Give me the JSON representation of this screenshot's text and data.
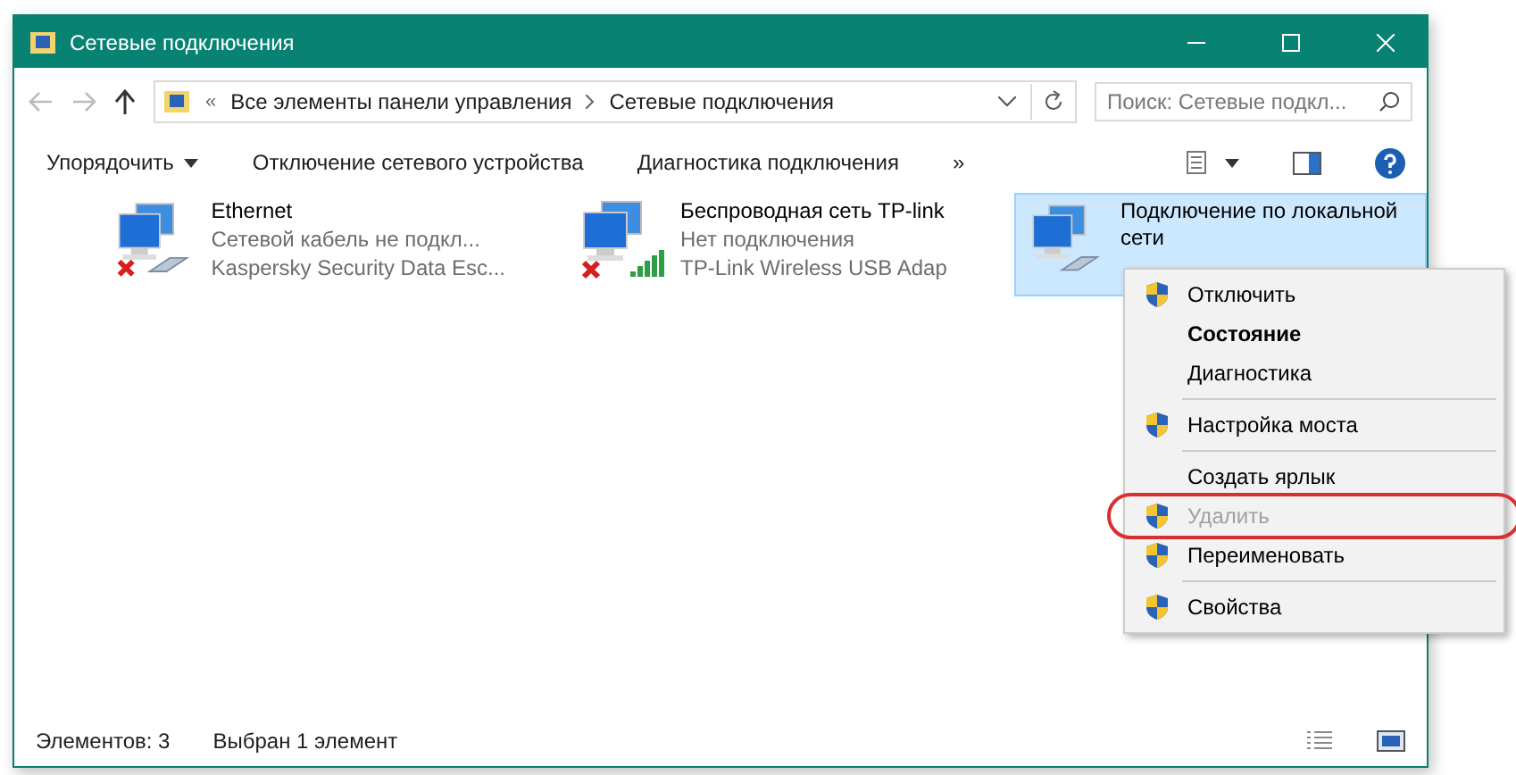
{
  "window": {
    "title": "Сетевые подключения"
  },
  "address": {
    "overflow": "«",
    "path": [
      "Все элементы панели управления",
      "Сетевые подключения"
    ],
    "search_placeholder": "Поиск: Сетевые подкл..."
  },
  "toolbar": {
    "buttons": [
      {
        "label": "Упорядочить",
        "dropdown": true
      },
      {
        "label": "Отключение сетевого устройства",
        "dropdown": false
      },
      {
        "label": "Диагностика подключения",
        "dropdown": false
      }
    ],
    "more": "»"
  },
  "connections": [
    {
      "name": "Ethernet",
      "lines": [
        "Сетевой кабель не подкл...",
        "Kaspersky Security Data Esc..."
      ],
      "kind": "cable",
      "error": true,
      "selected": false
    },
    {
      "name": "Беспроводная сеть TP-link",
      "lines": [
        "Нет подключения",
        "TP-Link Wireless USB Adap"
      ],
      "kind": "wifi",
      "error": true,
      "selected": false
    },
    {
      "name": "Подключение по локальной сети",
      "kind": "cable",
      "error": false,
      "selected": true
    }
  ],
  "context_menu": [
    {
      "kind": "item",
      "label": "Отключить",
      "shield": true,
      "bold": false,
      "disabled": false,
      "highlighted": false
    },
    {
      "kind": "item",
      "label": "Состояние",
      "shield": false,
      "bold": true,
      "disabled": false,
      "highlighted": false
    },
    {
      "kind": "item",
      "label": "Диагностика",
      "shield": false,
      "bold": false,
      "disabled": false,
      "highlighted": false
    },
    {
      "kind": "separator"
    },
    {
      "kind": "item",
      "label": "Настройка моста",
      "shield": true,
      "bold": false,
      "disabled": false,
      "highlighted": false
    },
    {
      "kind": "separator"
    },
    {
      "kind": "item",
      "label": "Создать ярлык",
      "shield": false,
      "bold": false,
      "disabled": false,
      "highlighted": false
    },
    {
      "kind": "item",
      "label": "Удалить",
      "shield": true,
      "bold": false,
      "disabled": true,
      "highlighted": true
    },
    {
      "kind": "item",
      "label": "Переименовать",
      "shield": true,
      "bold": false,
      "disabled": false,
      "highlighted": false
    },
    {
      "kind": "separator"
    },
    {
      "kind": "item",
      "label": "Свойства",
      "shield": true,
      "bold": false,
      "disabled": false,
      "highlighted": false
    }
  ],
  "status_bar": {
    "count": "Элементов: 3",
    "selection": "Выбран 1 элемент"
  }
}
